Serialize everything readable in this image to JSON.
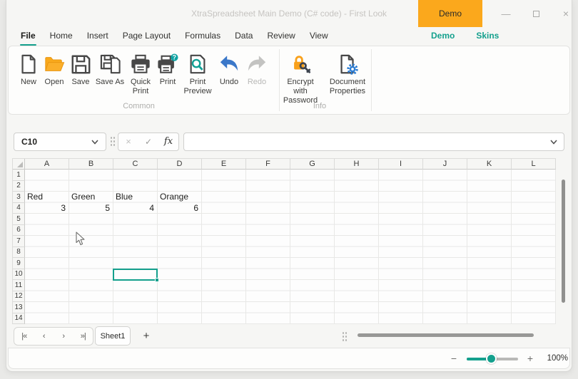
{
  "window": {
    "title": "XtraSpreadsheet Main Demo (C# code) - First Look",
    "demo_button_label": "Demo",
    "controls": {
      "minimize_glyph": "—",
      "close_glyph": "×"
    }
  },
  "tabs": {
    "items": [
      "File",
      "Home",
      "Insert",
      "Page Layout",
      "Formulas",
      "Data",
      "Review",
      "View"
    ],
    "selected": "File",
    "right_items": [
      "Demo",
      "Skins"
    ]
  },
  "ribbon": {
    "groups": [
      {
        "label": "Common",
        "buttons": [
          "New",
          "Open",
          "Save",
          "Save As",
          "Quick Print",
          "Print",
          "Print Preview",
          "Undo",
          "Redo"
        ]
      },
      {
        "label": "Info",
        "buttons": [
          "Encrypt with Password",
          "Document Properties"
        ]
      }
    ],
    "disabled_buttons": [
      "Redo"
    ]
  },
  "formula_bar": {
    "cell_reference": "C10",
    "formula_value": "",
    "cancel_glyph": "×",
    "enter_glyph": "✓",
    "function_label": "fx"
  },
  "grid": {
    "columns": [
      "A",
      "B",
      "C",
      "D",
      "E",
      "F",
      "G",
      "H",
      "I",
      "J",
      "K",
      "L"
    ],
    "rows": [
      "1",
      "2",
      "3",
      "4",
      "5",
      "6",
      "7",
      "8",
      "9",
      "10",
      "11",
      "12",
      "13",
      "14"
    ],
    "cells": [
      {
        "ref": "A3",
        "value": "Red",
        "align": "left"
      },
      {
        "ref": "B3",
        "value": "Green",
        "align": "left"
      },
      {
        "ref": "C3",
        "value": "Blue",
        "align": "left"
      },
      {
        "ref": "D3",
        "value": "Orange",
        "align": "left"
      },
      {
        "ref": "A4",
        "value": "3",
        "align": "right"
      },
      {
        "ref": "B4",
        "value": "5",
        "align": "right"
      },
      {
        "ref": "C4",
        "value": "4",
        "align": "right"
      },
      {
        "ref": "D4",
        "value": "6",
        "align": "right"
      }
    ],
    "selected_cell": "C10"
  },
  "sheet_bar": {
    "nav_glyphs": [
      "|«",
      "‹",
      "›",
      "»|"
    ],
    "nav_names": [
      "first",
      "previous",
      "next",
      "last"
    ],
    "tab_label": "Sheet1",
    "add_glyph": "+"
  },
  "status_bar": {
    "zoom_out_glyph": "−",
    "zoom_in_glyph": "+",
    "zoom_percent": "100%"
  },
  "colors": {
    "accent_teal": "#14a08d",
    "brand_orange": "#fba81c",
    "undo_blue": "#3b78c9",
    "gear_blue": "#2b7cd3",
    "badge_teal": "#0fa3a3"
  }
}
